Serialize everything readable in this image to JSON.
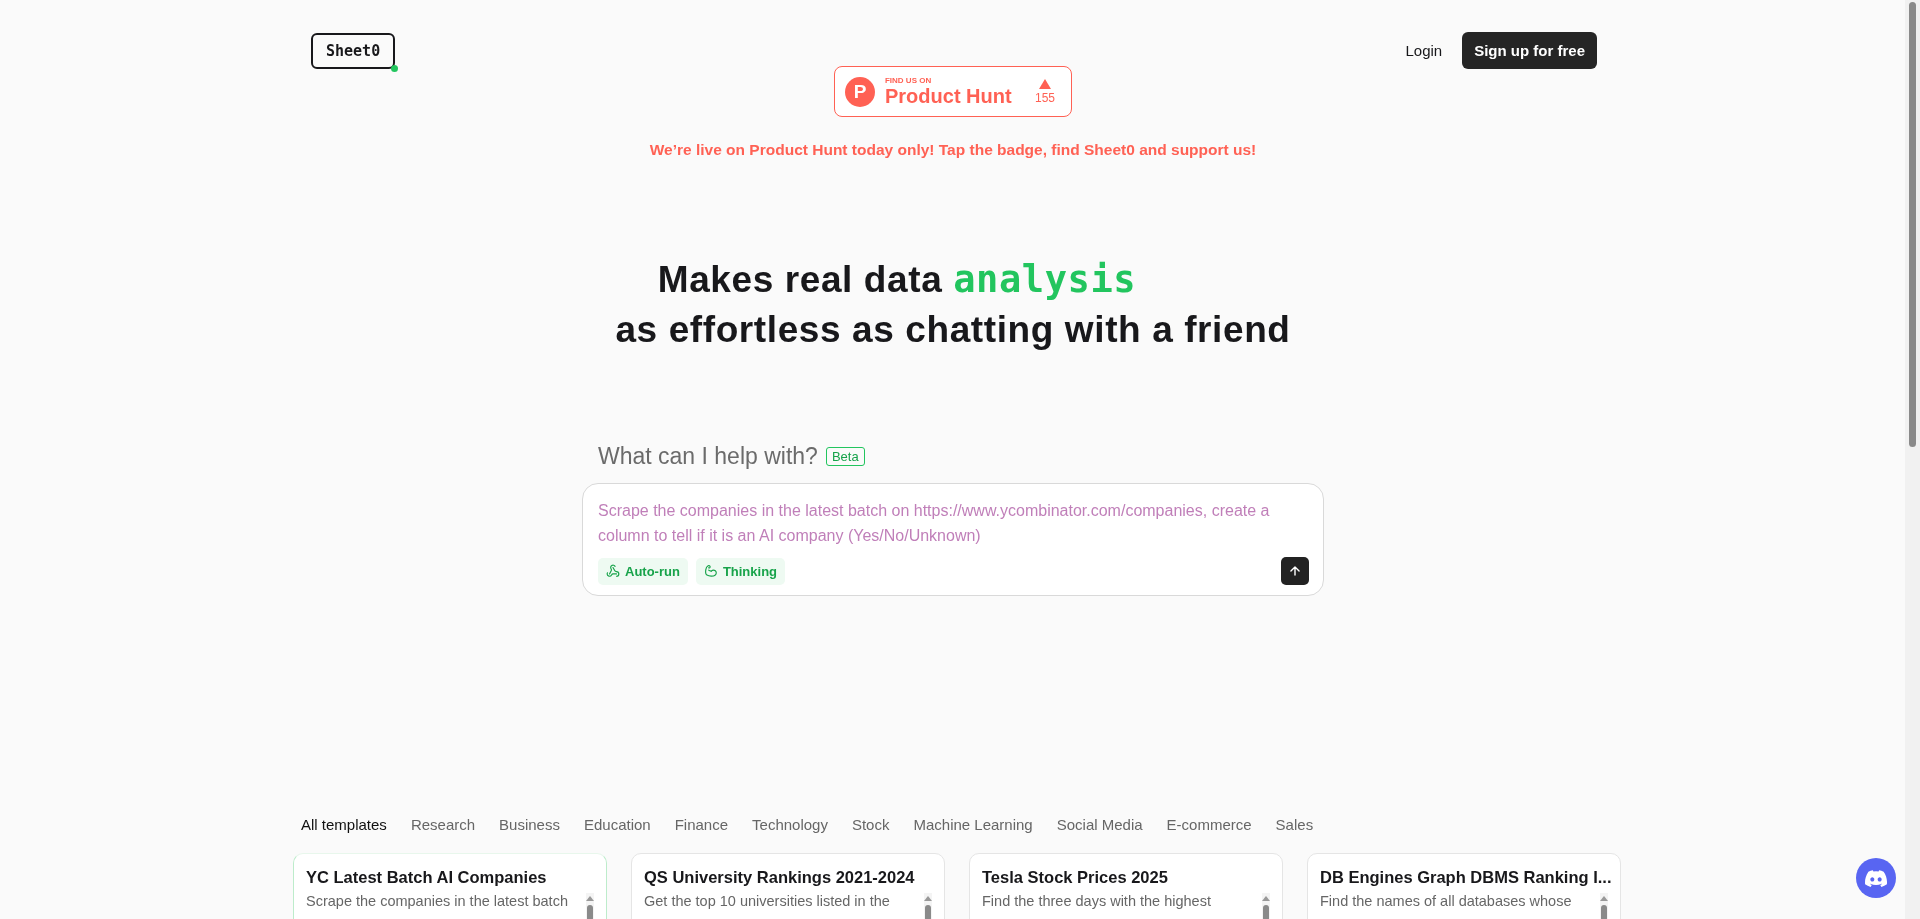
{
  "header": {
    "logo": "Sheet0",
    "login": "Login",
    "signup": "Sign up for free"
  },
  "product_hunt": {
    "eyebrow": "FIND US ON",
    "name": "Product Hunt",
    "letter": "P",
    "upvotes": "155",
    "announcement": "We’re live on Product Hunt today only! Tap the badge, find Sheet0 and support us!"
  },
  "headline": {
    "lead": "Makes real data",
    "highlight": "analysis",
    "line2": "as effortless as chatting with a friend"
  },
  "prompt": {
    "title": "What can I help with?",
    "badge": "Beta",
    "placeholder": "Scrape the companies in the latest batch on https://www.ycombinator.com/companies, create a column to tell if it is an AI company (Yes/No/Unknown)",
    "chips": [
      {
        "label": "Auto-run",
        "kind": "webhook"
      },
      {
        "label": "Thinking",
        "kind": "muscle"
      }
    ]
  },
  "tabs": [
    {
      "label": "All templates",
      "selected": true
    },
    {
      "label": "Research",
      "selected": false
    },
    {
      "label": "Business",
      "selected": false
    },
    {
      "label": "Education",
      "selected": false
    },
    {
      "label": "Finance",
      "selected": false
    },
    {
      "label": "Technology",
      "selected": false
    },
    {
      "label": "Stock",
      "selected": false
    },
    {
      "label": "Machine Learning",
      "selected": false
    },
    {
      "label": "Social Media",
      "selected": false
    },
    {
      "label": "E-commerce",
      "selected": false
    },
    {
      "label": "Sales",
      "selected": false
    }
  ],
  "templates": [
    {
      "title": "YC Latest Batch AI Companies",
      "description": "Scrape the companies in the latest batch",
      "selected": true
    },
    {
      "title": "QS University Rankings 2021-2024",
      "description": "Get the top 10 universities listed in the",
      "selected": false
    },
    {
      "title": "Tesla Stock Prices 2025",
      "description": "Find the three days with the highest",
      "selected": false
    },
    {
      "title": "DB Engines Graph DBMS Ranking I...",
      "description": "Find the names of all databases whose",
      "selected": false
    }
  ]
}
